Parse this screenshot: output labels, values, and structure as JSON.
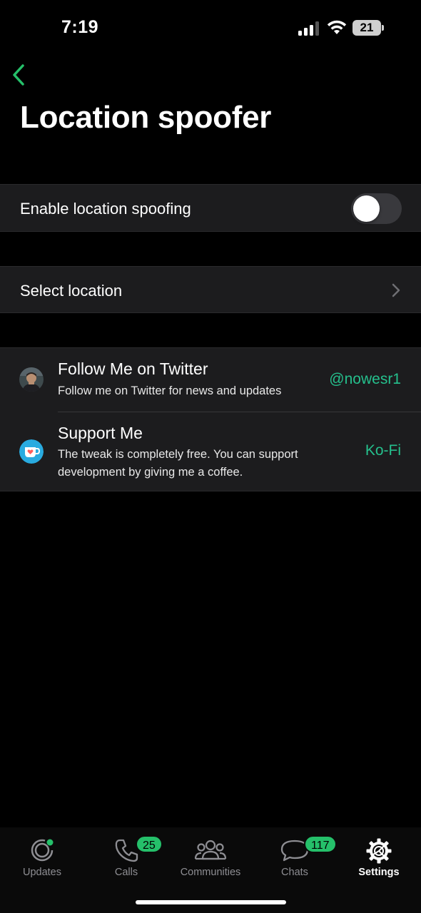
{
  "status": {
    "time": "7:19",
    "battery": "21"
  },
  "header": {
    "title": "Location spoofer"
  },
  "toggle_section": {
    "label": "Enable location spoofing",
    "enabled": false
  },
  "location_section": {
    "label": "Select location"
  },
  "links": [
    {
      "title": "Follow Me on Twitter",
      "subtitle": "Follow me on Twitter for news and updates",
      "value": "@nowesr1",
      "icon": "avatar-photo"
    },
    {
      "title": "Support Me",
      "subtitle": "The tweak is completely free. You can support development by giving me a coffee.",
      "value": "Ko-Fi",
      "icon": "kofi-cup-icon"
    }
  ],
  "tabs": [
    {
      "label": "Updates",
      "icon": "updates-icon"
    },
    {
      "label": "Calls",
      "icon": "phone-icon",
      "badge": "25"
    },
    {
      "label": "Communities",
      "icon": "communities-icon"
    },
    {
      "label": "Chats",
      "icon": "chats-icon",
      "badge": "117"
    },
    {
      "label": "Settings",
      "icon": "settings-gear-icon",
      "active": true
    }
  ],
  "colors": {
    "accent_green": "#25c06a",
    "link_teal": "#25c08d",
    "background": "#000000",
    "cell": "#1c1c1e"
  }
}
